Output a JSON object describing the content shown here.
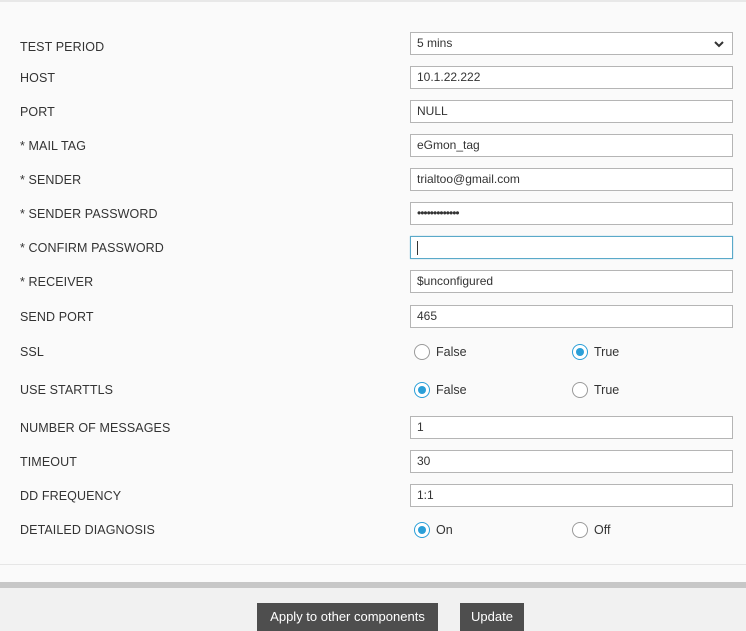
{
  "form": {
    "test_period": {
      "label": "TEST PERIOD",
      "value": "5 mins"
    },
    "host": {
      "label": "HOST",
      "value": "10.1.22.222"
    },
    "port": {
      "label": "PORT",
      "value": "NULL"
    },
    "mail_tag": {
      "label": "* MAIL TAG",
      "value": "eGmon_tag"
    },
    "sender": {
      "label": "* SENDER",
      "value": "trialtoo@gmail.com"
    },
    "sender_password": {
      "label": "* SENDER PASSWORD",
      "value": "•••••••••••••"
    },
    "confirm_password": {
      "label": "* CONFIRM PASSWORD",
      "value": ""
    },
    "receiver": {
      "label": "* RECEIVER",
      "value": "$unconfigured"
    },
    "send_port": {
      "label": "SEND PORT",
      "value": "465"
    },
    "ssl": {
      "label": "SSL",
      "option1": "False",
      "option2": "True",
      "selected": "True"
    },
    "use_starttls": {
      "label": "USE STARTTLS",
      "option1": "False",
      "option2": "True",
      "selected": "False"
    },
    "number_of_messages": {
      "label": "NUMBER OF MESSAGES",
      "value": "1"
    },
    "timeout": {
      "label": "TIMEOUT",
      "value": "30"
    },
    "dd_frequency": {
      "label": "DD FREQUENCY",
      "value": "1:1"
    },
    "detailed_diagnosis": {
      "label": "DETAILED DIAGNOSIS",
      "option1": "On",
      "option2": "Off",
      "selected": "On"
    }
  },
  "buttons": {
    "apply_label": "Apply to other components",
    "update_label": "Update"
  },
  "icons": {
    "select": "chevron-down-icon"
  },
  "colors": {
    "accent": "#2a9fd8",
    "button_bg": "#4e4e4e",
    "focus_border": "#5aa9c9"
  }
}
